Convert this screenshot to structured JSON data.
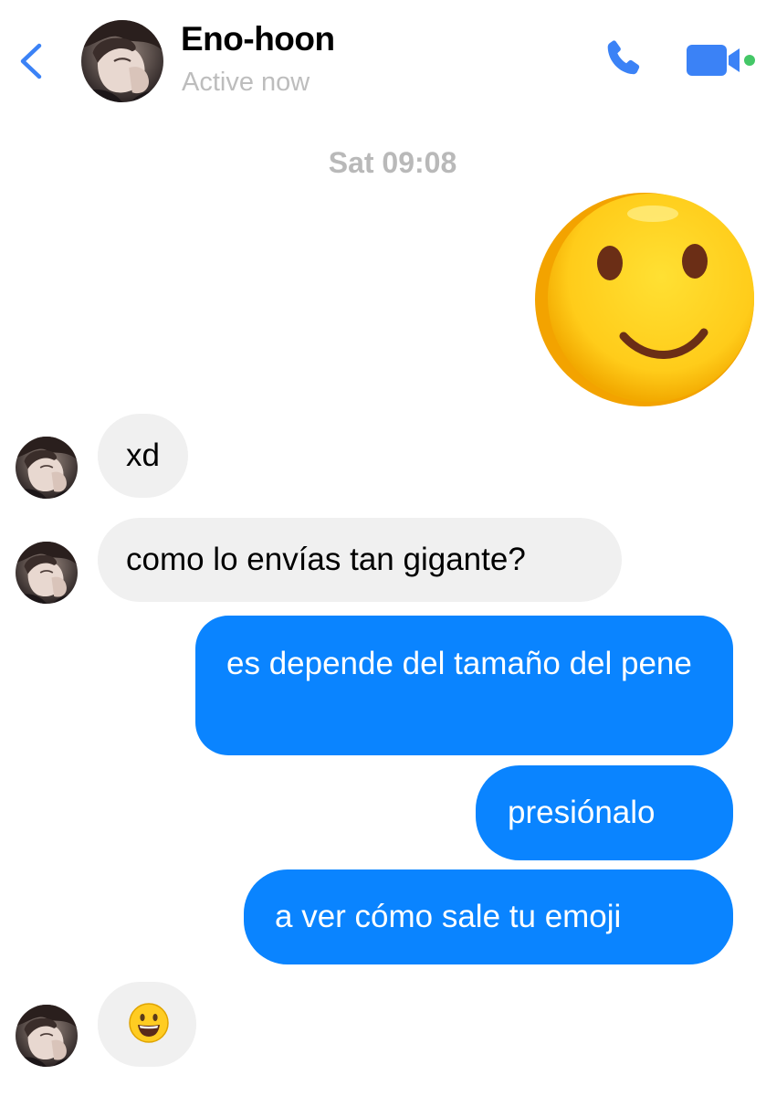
{
  "header": {
    "contact_name": "Eno-hoon",
    "status": "Active now",
    "back_icon": "chevron-left-icon",
    "call_icon": "phone-icon",
    "video_icon": "video-camera-icon",
    "online_dot_color": "#44c767",
    "accent_color": "#3b82f6"
  },
  "conversation": {
    "timestamp": "Sat 09:08",
    "big_emoji": "slightly-smiling-face-emoji",
    "messages": [
      {
        "direction": "incoming",
        "text": "xd"
      },
      {
        "direction": "incoming",
        "text": "como lo envías tan gigante?"
      },
      {
        "direction": "outgoing",
        "text": "es depende del tamaño del pene"
      },
      {
        "direction": "outgoing",
        "text": "presiónalo"
      },
      {
        "direction": "outgoing",
        "text": "a ver cómo sale tu emoji"
      },
      {
        "direction": "incoming",
        "text": "😃",
        "emoji_name": "smiling-face-with-open-mouth-emoji"
      }
    ]
  },
  "colors": {
    "outgoing_bubble": "#0a84ff",
    "incoming_bubble": "#f0f0f0",
    "timestamp_text": "#b9b9b9",
    "status_text": "#bdbdbd"
  }
}
